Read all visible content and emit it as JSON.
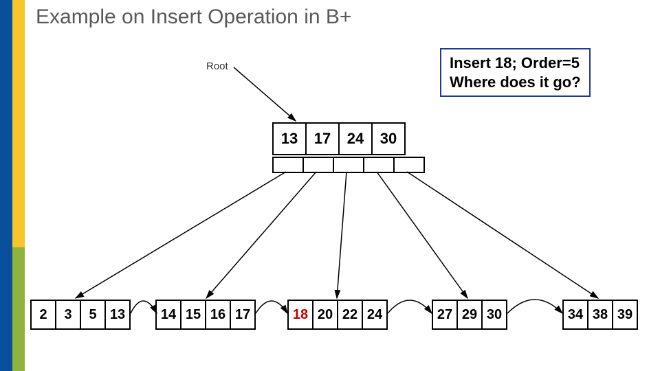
{
  "title": "Example on Insert Operation in B+",
  "root_label": "Root",
  "callout_line1": "Insert 18; Order=5",
  "callout_line2": "Where does it go?",
  "internal_keys": [
    "13",
    "17",
    "24",
    "30"
  ],
  "leaves": [
    {
      "cells": [
        "2",
        "3",
        "5",
        "13"
      ],
      "highlight": []
    },
    {
      "cells": [
        "14",
        "15",
        "16",
        "17"
      ],
      "highlight": []
    },
    {
      "cells": [
        "18",
        "20",
        "22",
        "24"
      ],
      "highlight": [
        0
      ]
    },
    {
      "cells": [
        "27",
        "29",
        "30"
      ],
      "highlight": []
    },
    {
      "cells": [
        "34",
        "38",
        "39"
      ],
      "highlight": []
    }
  ],
  "chart_data": {
    "type": "diagram",
    "structure": "B+ tree",
    "order": 5,
    "insert_value": 18,
    "root_keys": [
      13,
      17,
      24,
      30
    ],
    "leaf_nodes": [
      [
        2,
        3,
        5,
        13
      ],
      [
        14,
        15,
        16,
        17
      ],
      [
        18,
        20,
        22,
        24
      ],
      [
        27,
        29,
        30
      ],
      [
        34,
        38,
        39
      ]
    ],
    "highlighted_value": 18
  }
}
